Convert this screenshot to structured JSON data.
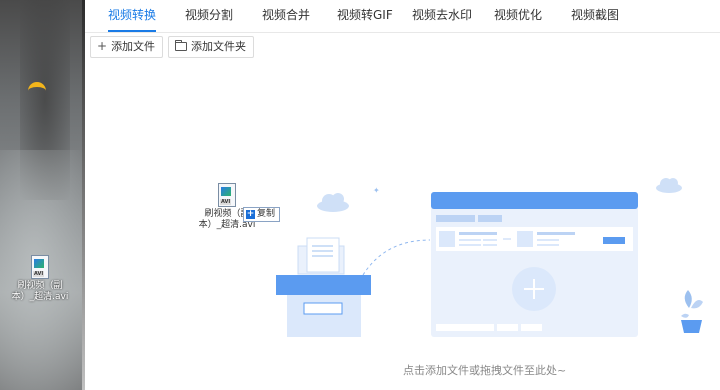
{
  "tabs": [
    {
      "label": "视频转换",
      "active": true
    },
    {
      "label": "视频分割",
      "active": false
    },
    {
      "label": "视频合并",
      "active": false
    },
    {
      "label": "视频转GIF",
      "active": false
    },
    {
      "label": "视频去水印",
      "active": false
    },
    {
      "label": "视频优化",
      "active": false
    },
    {
      "label": "视频截图",
      "active": false
    }
  ],
  "toolbar": {
    "add_file_label": "添加文件",
    "add_folder_label": "添加文件夹"
  },
  "desktop_file": {
    "label_line1": "刷视频（副",
    "label_line2": "本）_超清.avi",
    "ext": "AVI"
  },
  "drag_file": {
    "label_line1": "刷视频（副",
    "label_line2": "本）_超清.avi",
    "ext": "AVI",
    "badge_label": "复制"
  },
  "drop_hint": "点击添加文件或拖拽文件至此处~",
  "colors": {
    "accent": "#1a7be6",
    "illustration_blue": "#5b9bf0",
    "illustration_light": "#dbe8fb"
  }
}
